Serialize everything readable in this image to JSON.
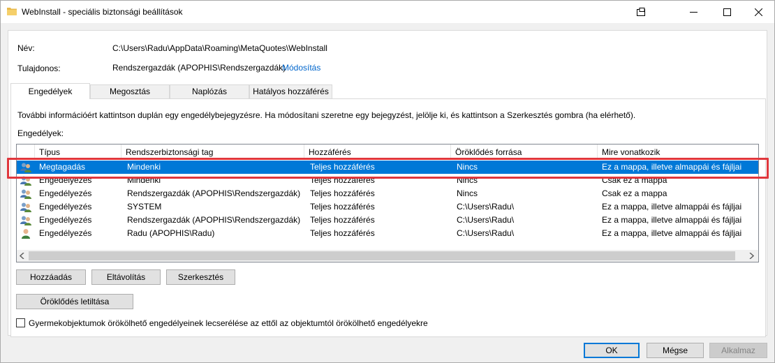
{
  "window": {
    "title": "WebInstall - speciális biztonsági beállítások",
    "icon": "folder-icon"
  },
  "info": {
    "name_label": "Név:",
    "name_value": "C:\\Users\\Radu\\AppData\\Roaming\\MetaQuotes\\WebInstall",
    "owner_label": "Tulajdonos:",
    "owner_value": "Rendszergazdák (APOPHIS\\Rendszergazdák)",
    "change_link": "Módosítás"
  },
  "tabs": [
    {
      "label": "Engedélyek",
      "active": true
    },
    {
      "label": "Megosztás",
      "active": false
    },
    {
      "label": "Naplózás",
      "active": false
    },
    {
      "label": "Hatályos hozzáférés",
      "active": false
    }
  ],
  "panel": {
    "info_text": "További információért kattintson duplán egy engedélybejegyzésre. Ha módosítani szeretne egy bejegyzést, jelölje ki, és kattintson a Szerkesztés gombra (ha elérhető).",
    "list_label": "Engedélyek:"
  },
  "columns": [
    "Típus",
    "Rendszerbiztonsági tag",
    "Hozzáférés",
    "Öröklődés forrása",
    "Mire vonatkozik"
  ],
  "rows": [
    {
      "type": "Megtagadás",
      "principal": "Mindenki",
      "access": "Teljes hozzáférés",
      "inherited_from": "Nincs",
      "applies_to": "Ez a mappa, illetve almappái és fájljai",
      "icon": "group-icon",
      "selected": true
    },
    {
      "type": "Engedélyezés",
      "principal": "Mindenki",
      "access": "Teljes hozzáférés",
      "inherited_from": "Nincs",
      "applies_to": "Csak ez a mappa",
      "icon": "group-icon",
      "selected": false
    },
    {
      "type": "Engedélyezés",
      "principal": "Rendszergazdák (APOPHIS\\Rendszergazdák)",
      "access": "Teljes hozzáférés",
      "inherited_from": "Nincs",
      "applies_to": "Csak ez a mappa",
      "icon": "group-icon",
      "selected": false
    },
    {
      "type": "Engedélyezés",
      "principal": "SYSTEM",
      "access": "Teljes hozzáférés",
      "inherited_from": "C:\\Users\\Radu\\",
      "applies_to": "Ez a mappa, illetve almappái és fájljai",
      "icon": "group-icon",
      "selected": false
    },
    {
      "type": "Engedélyezés",
      "principal": "Rendszergazdák (APOPHIS\\Rendszergazdák)",
      "access": "Teljes hozzáférés",
      "inherited_from": "C:\\Users\\Radu\\",
      "applies_to": "Ez a mappa, illetve almappái és fájljai",
      "icon": "group-icon",
      "selected": false
    },
    {
      "type": "Engedélyezés",
      "principal": "Radu (APOPHIS\\Radu)",
      "access": "Teljes hozzáférés",
      "inherited_from": "C:\\Users\\Radu\\",
      "applies_to": "Ez a mappa, illetve almappái és fájljai",
      "icon": "user-icon",
      "selected": false
    }
  ],
  "buttons": {
    "add": "Hozzáadás",
    "remove": "Eltávolítás",
    "edit": "Szerkesztés",
    "disable_inheritance": "Öröklődés letiltása",
    "ok": "OK",
    "cancel": "Mégse",
    "apply": "Alkalmaz"
  },
  "checkbox": {
    "label": "Gyermekobjektumok örökölhető engedélyeinek lecserélése az ettől az objektumtól örökölhető engedélyekre",
    "checked": false
  },
  "colors": {
    "selection": "#0078d7",
    "highlight_box": "#e0373d",
    "link": "#0066cc"
  }
}
